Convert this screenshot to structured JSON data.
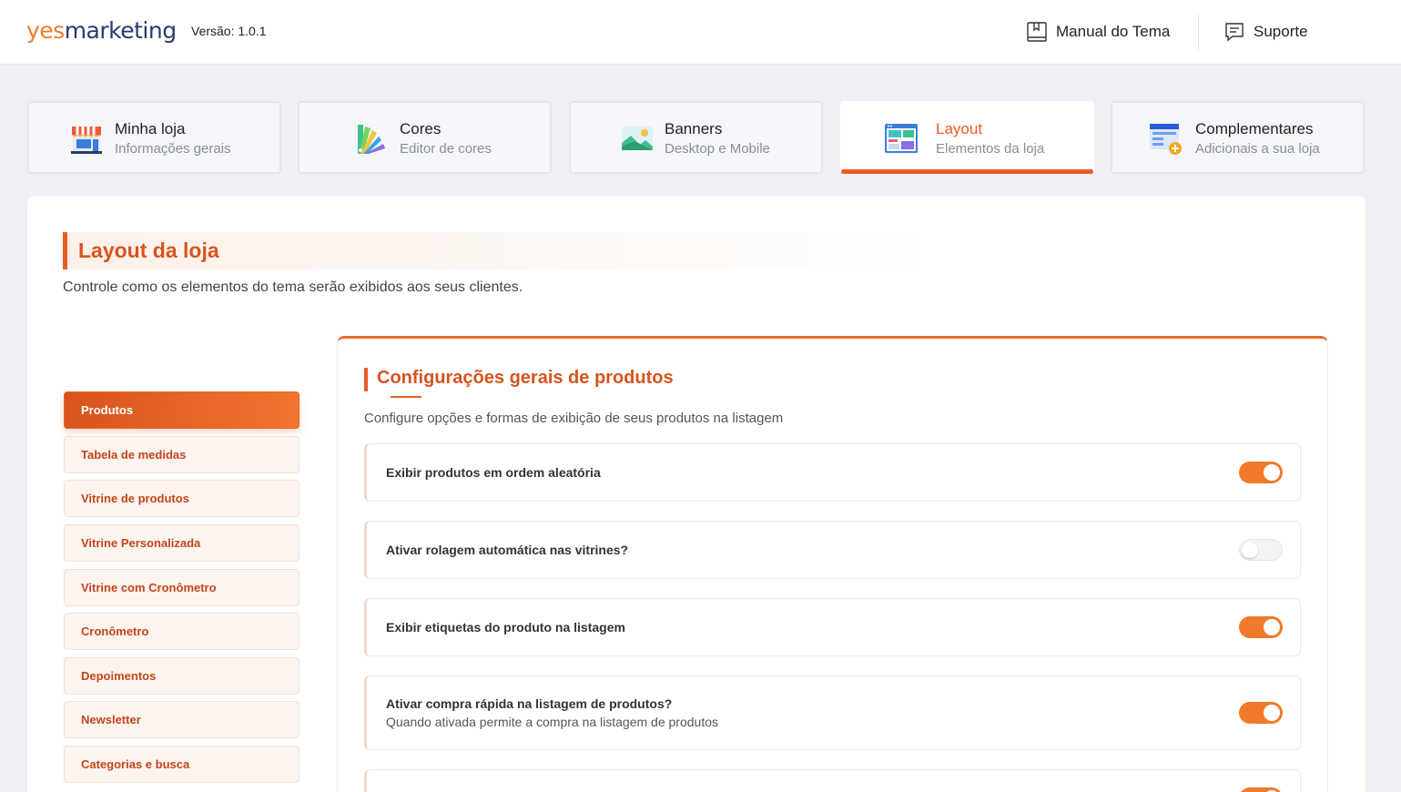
{
  "header": {
    "logo_yes": "yes",
    "logo_rest": "marketing",
    "version": "Versão: 1.0.1",
    "manual_label": "Manual do Tema",
    "support_label": "Suporte"
  },
  "tabs": [
    {
      "title": "Minha loja",
      "subtitle": "Informações gerais",
      "icon": "store-icon"
    },
    {
      "title": "Cores",
      "subtitle": "Editor de cores",
      "icon": "palette-icon"
    },
    {
      "title": "Banners",
      "subtitle": "Desktop e Mobile",
      "icon": "image-icon"
    },
    {
      "title": "Layout",
      "subtitle": "Elementos da loja",
      "icon": "layout-icon",
      "active": true
    },
    {
      "title": "Complementares",
      "subtitle": "Adicionais a sua loja",
      "icon": "add-ons-icon"
    }
  ],
  "page": {
    "title": "Layout da loja",
    "description": "Controle como os elementos do tema serão exibidos aos seus clientes."
  },
  "sidebar": {
    "items": [
      {
        "label": "Produtos",
        "active": true
      },
      {
        "label": "Tabela de medidas"
      },
      {
        "label": "Vitrine de produtos"
      },
      {
        "label": "Vitrine Personalizada"
      },
      {
        "label": "Vitrine com Cronômetro"
      },
      {
        "label": "Cronômetro"
      },
      {
        "label": "Depoimentos"
      },
      {
        "label": "Newsletter"
      },
      {
        "label": "Categorias e busca"
      }
    ]
  },
  "panel": {
    "title": "Configurações gerais de produtos",
    "description": "Configure opções e formas de exibição de seus produtos na listagem",
    "options": [
      {
        "label": "Exibir produtos em ordem aleatória",
        "enabled": true
      },
      {
        "label": "Ativar rolagem automática nas vitrines?",
        "enabled": false
      },
      {
        "label": "Exibir etiquetas do produto na listagem",
        "enabled": true
      },
      {
        "label": "Ativar compra rápida na listagem de produtos?",
        "sublabel": "Quando ativada permite a compra na listagem de produtos",
        "enabled": true
      },
      {
        "label": "",
        "enabled": true
      }
    ]
  },
  "colors": {
    "accent": "#ea5b24",
    "accent_light": "#f07a2a",
    "brand_dark": "#2a3a6e"
  }
}
